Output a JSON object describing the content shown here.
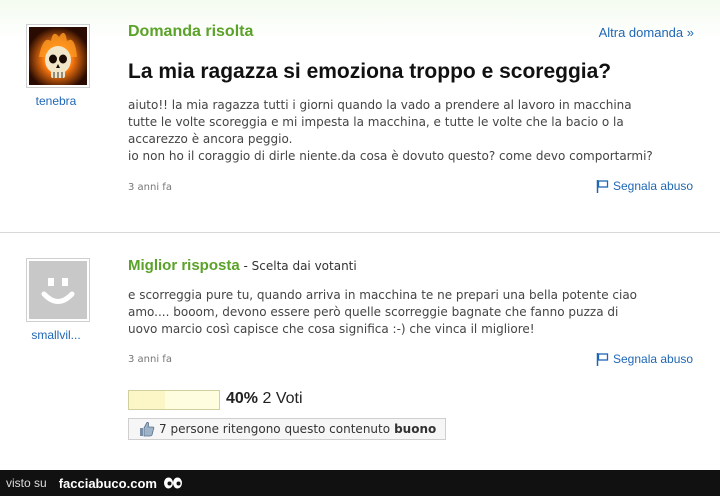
{
  "question": {
    "status_label": "Domanda risolta",
    "other_question_link": "Altra domanda »",
    "title": "La mia ragazza si emoziona troppo e scoreggia?",
    "author": "tenebra",
    "body_lines": [
      "aiuto!! la mia ragazza tutti i giorni quando la vado a prendere al lavoro in macchina",
      "tutte le volte scoreggia e mi impesta la macchina, e tutte le volte che la bacio o la",
      "accarezzo è ancora peggio.",
      "io non ho il coraggio di dirle niente.da cosa è dovuto questo? come devo comportarmi?"
    ],
    "time_ago": "3 anni fa",
    "report_label": "Segnala abuso"
  },
  "answer": {
    "heading": "Miglior risposta",
    "subheading": " - Scelta dai votanti",
    "author": "smallvil...",
    "body_lines": [
      "e scorreggia pure tu, quando arriva in macchina te ne prepari una bella potente ciao",
      "amo.... booom, devono essere però quelle scorreggie bagnate che fanno puzza di",
      "uovo marcio così capisce che cosa significa :-) che vinca il migliore!"
    ],
    "time_ago": "3 anni fa",
    "report_label": "Segnala abuso",
    "vote_percent": "40%",
    "vote_count": "2 Voti",
    "vote_fraction": 0.4,
    "thumbs_text": "7 persone ritengono questo contenuto",
    "thumbs_bold": "buono"
  },
  "footer": {
    "seen_on": "visto su",
    "brand": "facciabuco.com"
  },
  "colors": {
    "green_heading": "#5aa228",
    "link_blue": "#1f67b5",
    "footer_bg": "#111111"
  },
  "icons": [
    "skull-flame-icon",
    "smiley-avatar-icon",
    "flag-icon",
    "thumbs-up-icon",
    "eyes-icon"
  ]
}
